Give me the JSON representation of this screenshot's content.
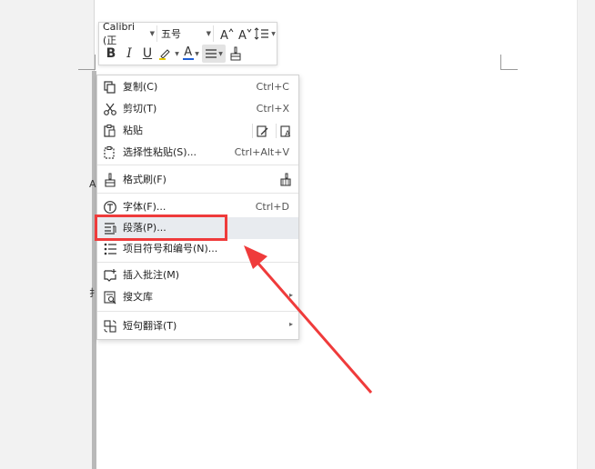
{
  "mini_toolbar": {
    "font_name": "Calibri (正",
    "font_size": "五号",
    "bold": "B",
    "italic": "I",
    "underline": "U",
    "font_color_letter": "A"
  },
  "menu": {
    "items": [
      {
        "label": "复制(C)",
        "shortcut": "Ctrl+C"
      },
      {
        "label": "剪切(T)",
        "shortcut": "Ctrl+X"
      },
      {
        "label": "粘贴",
        "shortcut": ""
      },
      {
        "label": "选择性粘贴(S)...",
        "shortcut": "Ctrl+Alt+V"
      },
      {
        "label": "格式刷(F)",
        "shortcut": ""
      },
      {
        "label": "字体(F)...",
        "shortcut": "Ctrl+D"
      },
      {
        "label": "段落(P)...",
        "shortcut": ""
      },
      {
        "label": "项目符号和编号(N)...",
        "shortcut": ""
      },
      {
        "label": "插入批注(M)",
        "shortcut": ""
      },
      {
        "label": "搜文库",
        "shortcut": ""
      },
      {
        "label": "短句翻译(T)",
        "shortcut": ""
      }
    ]
  },
  "doc_fragments": {
    "left_a": "A",
    "left_b": "扌"
  },
  "colors": {
    "highlight_row": "#e8ebef",
    "annotation_red": "#ef3b3b",
    "font_color_bar": "#1f5fd6"
  }
}
